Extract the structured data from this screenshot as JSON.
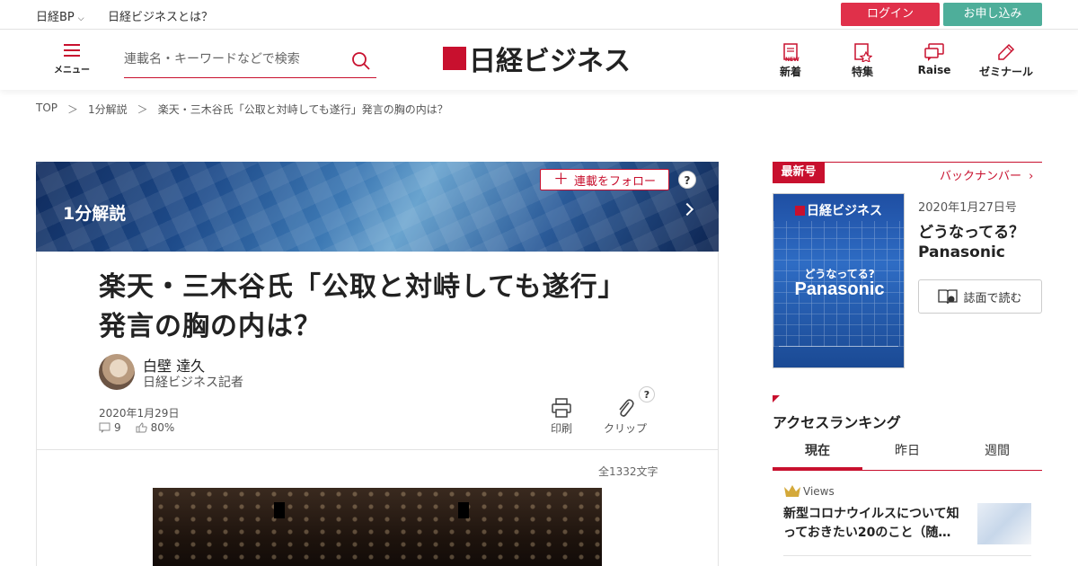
{
  "topbar": {
    "brand": "日経BP",
    "about": "日経ビジネスとは？",
    "login": "ログイン",
    "apply": "お申し込み"
  },
  "header": {
    "menu_label": "メニュー",
    "search_placeholder": "連載名・キーワードなどで検索",
    "logo_text": "日経ビジネス",
    "nav": [
      {
        "label": "新着",
        "icon": "new-icon"
      },
      {
        "label": "特集",
        "icon": "feature-icon"
      },
      {
        "label": "Raise",
        "icon": "raise-icon"
      },
      {
        "label": "ゼミナール",
        "icon": "pencil-icon"
      }
    ]
  },
  "breadcrumb": [
    "TOP",
    "1分解説",
    "楽天・三木谷氏「公取と対峙しても遂行」発言の胸の内は？"
  ],
  "breadcrumb_sep": "＞",
  "series": {
    "title": "1分解説",
    "follow_label": "連載をフォロー",
    "help": "?"
  },
  "article": {
    "title_line1": "楽天・三木谷氏「公取と対峙しても遂行」",
    "title_line2": "発言の胸の内は？",
    "author_name": "白壁 達久",
    "author_role": "日経ビジネス記者",
    "date": "2020年1月29日",
    "comments": "9",
    "likes": "80%",
    "print_label": "印刷",
    "clip_label": "クリップ",
    "clip_help": "?",
    "char_count": "全1332文字"
  },
  "sidebar": {
    "latest_tag": "最新号",
    "backnumber": "バックナンバー",
    "cover_logo": "日経ビジネス",
    "cover_sub": "どうなってる?",
    "cover_main": "Panasonic",
    "issue_date": "2020年1月27日号",
    "issue_title_line1": "どうなってる？",
    "issue_title_line2": "Panasonic",
    "read_label": "誌面で読む",
    "ranking_title": "アクセスランキング",
    "ranking_tabs": [
      "現在",
      "昨日",
      "週間"
    ],
    "ranking_item": {
      "views_label": "Views",
      "text": "新型コロナウイルスについて知っておきたい20のこと（随…"
    }
  },
  "colors": {
    "accent": "#c8102e",
    "login": "#e0304a",
    "apply": "#4eae9a"
  }
}
